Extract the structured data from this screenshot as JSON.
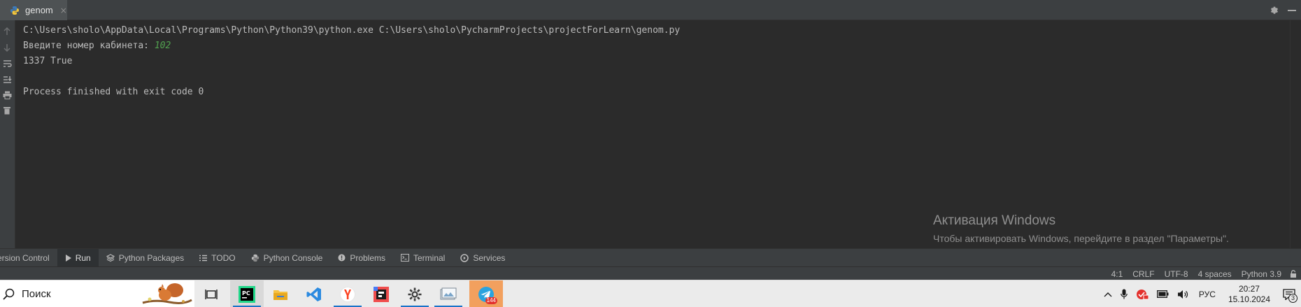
{
  "run_window": {
    "tab_label": "genom",
    "tab_close": "×"
  },
  "console": {
    "lines": [
      "C:\\Users\\sholo\\AppData\\Local\\Programs\\Python\\Python39\\python.exe C:\\Users\\sholo\\PycharmProjects\\projectForLearn\\genom.py",
      "Введите номер кабинета: ",
      "1337 True",
      "",
      "Process finished with exit code 0"
    ],
    "user_input": "102"
  },
  "watermark": {
    "title": "Активация Windows",
    "subtitle": "Чтобы активировать Windows, перейдите в раздел \"Параметры\"."
  },
  "tool_tabs": [
    {
      "label": "ersion Control"
    },
    {
      "label": "Run"
    },
    {
      "label": "Python Packages"
    },
    {
      "label": "TODO"
    },
    {
      "label": "Python Console"
    },
    {
      "label": "Problems"
    },
    {
      "label": "Terminal"
    },
    {
      "label": "Services"
    }
  ],
  "status_bar": {
    "position": "4:1",
    "line_separator": "CRLF",
    "encoding": "UTF-8",
    "indent": "4 spaces",
    "interpreter": "Python 3.9"
  },
  "taskbar": {
    "search_label": "Поиск",
    "telegram_badge": "144",
    "language": "РУС",
    "time": "20:27",
    "date": "15.10.2024",
    "notification_count": "3"
  },
  "colors": {
    "accent": "#1a73c8",
    "console_text": "#bbbbbb",
    "user_input": "#51a14f"
  }
}
